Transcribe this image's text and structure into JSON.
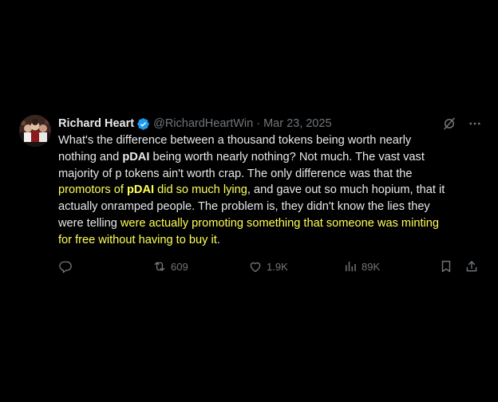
{
  "tweet": {
    "author_name": "Richard Heart",
    "handle": "@RichardHeartWin",
    "separator": "·",
    "date": "Mar 23, 2025",
    "body": {
      "l1": "What's the difference between a thousand tokens being worth nearly",
      "l2a": "nothing and ",
      "l2b": "pDAI",
      "l2c": " being worth nearly nothing? Not much. The vast vast",
      "l3": "majority of p tokens ain't worth crap. The only difference was that the",
      "l4a": "promotors of ",
      "l4b": "pDAI",
      "l4c": " did so much lying",
      "l4d": ", and gave out so much hopium, that it",
      "l5": "actually onramped people. The problem is, they didn't know the lies they",
      "l6a": "were telling ",
      "l6b": "were actually promoting something that someone was minting",
      "l7a": "for free without having to buy it",
      "l7b": "."
    },
    "stats": {
      "retweets": "609",
      "likes": "1.9K",
      "views": "89K"
    }
  },
  "colors": {
    "background": "#000000",
    "text": "#e7e9ea",
    "muted": "#71767b",
    "highlight": "#ffff57",
    "verified": "#1d9bf0"
  },
  "icons": {
    "verified": "verified-badge-icon",
    "grok": "grok-icon",
    "more": "more-icon",
    "reply": "reply-icon",
    "retweet": "retweet-icon",
    "like": "heart-icon",
    "views": "analytics-icon",
    "bookmark": "bookmark-icon",
    "share": "share-icon"
  }
}
